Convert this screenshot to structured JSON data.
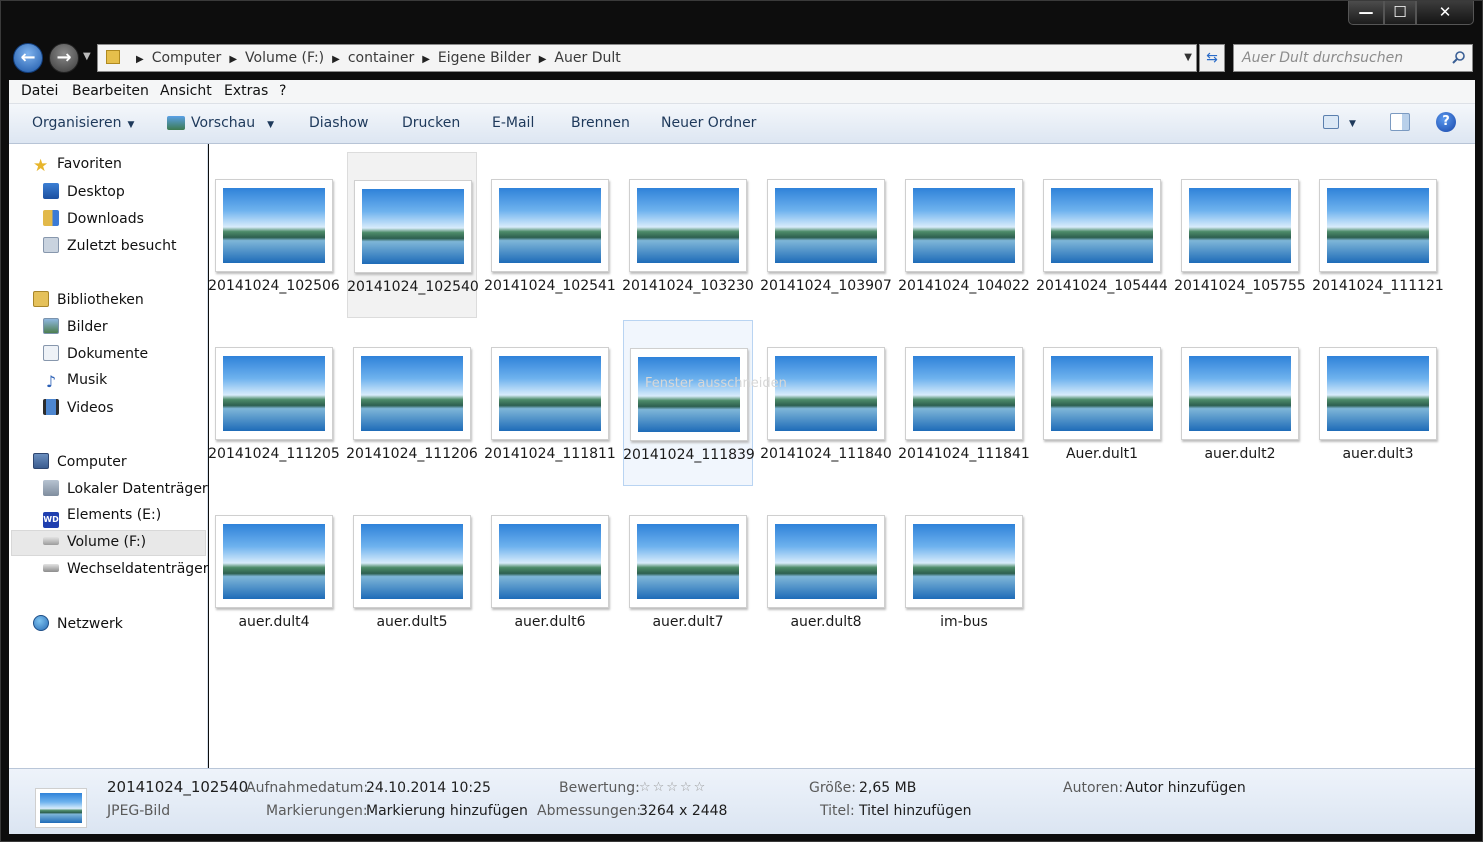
{
  "window": {
    "min": "—",
    "max": "☐",
    "close": "✕"
  },
  "address": {
    "crumbs": [
      "Computer",
      "Volume (F:)",
      "container",
      "Eigene Bilder",
      "Auer Dult"
    ],
    "search_placeholder": "Auer Dult durchsuchen"
  },
  "menu": [
    "Datei",
    "Bearbeiten",
    "Ansicht",
    "Extras",
    "?"
  ],
  "toolbar": [
    "Organisieren",
    "Vorschau",
    "Diashow",
    "Drucken",
    "E-Mail",
    "Brennen",
    "Neuer Ordner"
  ],
  "nav": {
    "favorites": "Favoriten",
    "desktop": "Desktop",
    "downloads": "Downloads",
    "recent": "Zuletzt besucht",
    "libraries": "Bibliotheken",
    "pictures": "Bilder",
    "documents": "Dokumente",
    "music": "Musik",
    "videos": "Videos",
    "computer": "Computer",
    "local": "Lokaler Datenträger",
    "elements": "Elements (E:)",
    "volume": "Volume (F:)",
    "removable": "Wechseldatenträger",
    "network": "Netzwerk"
  },
  "files": [
    "20141024_102506",
    "20141024_102540",
    "20141024_102541",
    "20141024_103230",
    "20141024_103907",
    "20141024_104022",
    "20141024_105444",
    "20141024_105755",
    "20141024_111121",
    "20141024_111205",
    "20141024_111206",
    "20141024_111811",
    "20141024_111839",
    "20141024_111840",
    "20141024_111841",
    "Auer.dult1",
    "auer.dult2",
    "auer.dult3",
    "auer.dult4",
    "auer.dult5",
    "auer.dult6",
    "auer.dult7",
    "auer.dult8",
    "im-bus"
  ],
  "ghost_text": "Fenster ausschneiden",
  "status": {
    "name": "20141024_102540",
    "type": "JPEG-Bild",
    "date_k": "Aufnahmedatum:",
    "date_v": "24.10.2014 10:25",
    "tags_k": "Markierungen:",
    "tags_v": "Markierung hinzufügen",
    "rating_k": "Bewertung:",
    "rating_v": "☆☆☆☆☆",
    "dims_k": "Abmessungen:",
    "dims_v": "3264 x 2448",
    "size_k": "Größe:",
    "size_v": "2,65 MB",
    "title_k": "Titel:",
    "title_v": "Titel hinzufügen",
    "authors_k": "Autoren:",
    "authors_v": "Autor hinzufügen"
  }
}
